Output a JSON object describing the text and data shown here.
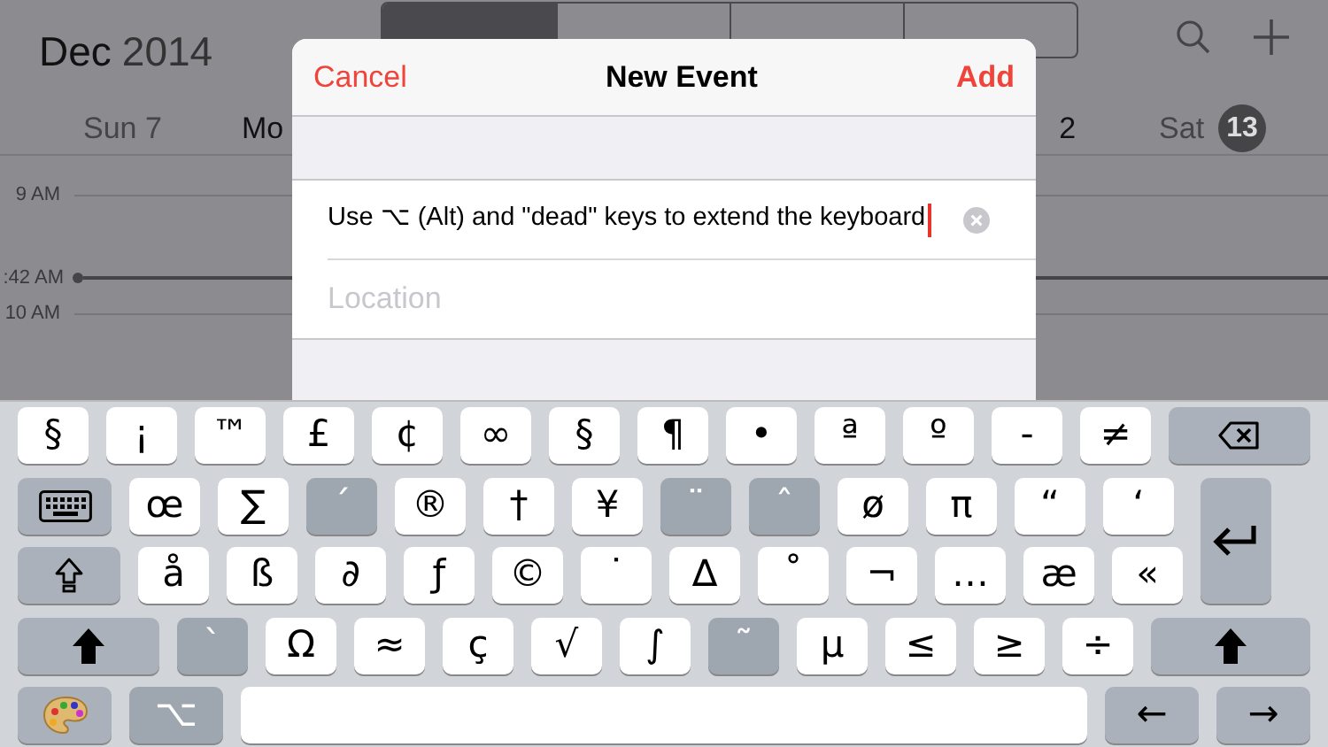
{
  "calendar": {
    "month": "Dec",
    "year": "2014",
    "segments": [
      {
        "selected": true
      },
      {
        "selected": false
      },
      {
        "selected": false
      },
      {
        "selected": false
      }
    ],
    "days": [
      {
        "label": "Sun 7"
      },
      {
        "label": "Mo"
      },
      {
        "label": "2"
      },
      {
        "label": "Sat",
        "badge": "13"
      }
    ],
    "times": [
      {
        "label": "9 AM",
        "kind": "hour"
      },
      {
        "label": ":42 AM",
        "kind": "now"
      },
      {
        "label": "10 AM",
        "kind": "hour"
      }
    ]
  },
  "dialog": {
    "cancel": "Cancel",
    "title": "New Event",
    "add": "Add",
    "title_field": {
      "value": "Use ⌥ (Alt) and \"dead\" keys to extend the keyboard"
    },
    "location_field": {
      "placeholder": "Location"
    }
  },
  "keyboard": {
    "rows": [
      [
        {
          "label": "§",
          "kind": "char"
        },
        {
          "label": "¡",
          "kind": "char"
        },
        {
          "label": "™",
          "kind": "char"
        },
        {
          "label": "£",
          "kind": "char"
        },
        {
          "label": "¢",
          "kind": "char"
        },
        {
          "label": "∞",
          "kind": "char"
        },
        {
          "label": "§",
          "kind": "char"
        },
        {
          "label": "¶",
          "kind": "char"
        },
        {
          "label": "•",
          "kind": "char"
        },
        {
          "label": "ª",
          "kind": "char"
        },
        {
          "label": "º",
          "kind": "char"
        },
        {
          "label": "-",
          "kind": "char"
        },
        {
          "label": "≠",
          "kind": "char"
        },
        {
          "kind": "delete"
        }
      ],
      [
        {
          "kind": "keyboard"
        },
        {
          "label": "œ",
          "kind": "char"
        },
        {
          "label": "∑",
          "kind": "char"
        },
        {
          "label": "´",
          "kind": "dead"
        },
        {
          "label": "®",
          "kind": "char"
        },
        {
          "label": "†",
          "kind": "char"
        },
        {
          "label": "¥",
          "kind": "char"
        },
        {
          "label": "¨",
          "kind": "dead"
        },
        {
          "label": "ˆ",
          "kind": "dead"
        },
        {
          "label": "ø",
          "kind": "char"
        },
        {
          "label": "π",
          "kind": "char"
        },
        {
          "label": "“",
          "kind": "char"
        },
        {
          "label": "‘",
          "kind": "char"
        }
      ],
      [
        {
          "kind": "caps"
        },
        {
          "label": "å",
          "kind": "char"
        },
        {
          "label": "ß",
          "kind": "char"
        },
        {
          "label": "∂",
          "kind": "char"
        },
        {
          "label": "ƒ",
          "kind": "char"
        },
        {
          "label": "©",
          "kind": "char"
        },
        {
          "label": "˙",
          "kind": "char"
        },
        {
          "label": "∆",
          "kind": "char"
        },
        {
          "label": "˚",
          "kind": "char"
        },
        {
          "label": "¬",
          "kind": "char"
        },
        {
          "label": "…",
          "kind": "char"
        },
        {
          "label": "æ",
          "kind": "char"
        },
        {
          "label": "«",
          "kind": "char"
        }
      ],
      [
        {
          "kind": "shift"
        },
        {
          "label": "`",
          "kind": "dead"
        },
        {
          "label": "Ω",
          "kind": "char"
        },
        {
          "label": "≈",
          "kind": "char"
        },
        {
          "label": "ç",
          "kind": "char"
        },
        {
          "label": "√",
          "kind": "char"
        },
        {
          "label": "∫",
          "kind": "char"
        },
        {
          "label": "˜",
          "kind": "dead"
        },
        {
          "label": "µ",
          "kind": "char"
        },
        {
          "label": "≤",
          "kind": "char"
        },
        {
          "label": "≥",
          "kind": "char"
        },
        {
          "label": "÷",
          "kind": "char"
        },
        {
          "kind": "shift"
        }
      ],
      [
        {
          "kind": "palette"
        },
        {
          "label": "⌥",
          "kind": "alt"
        },
        {
          "kind": "space"
        },
        {
          "label": "←",
          "kind": "arrow"
        },
        {
          "label": "→",
          "kind": "arrow"
        }
      ]
    ],
    "return_key": {
      "kind": "return"
    }
  }
}
